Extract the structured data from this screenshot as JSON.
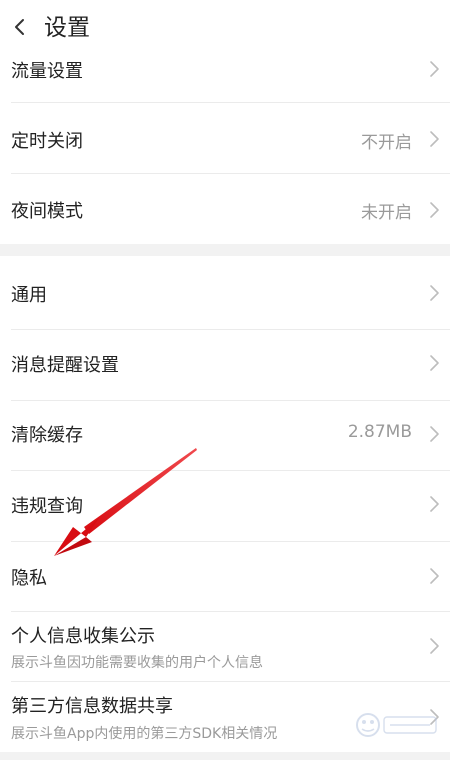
{
  "header": {
    "title": "设置"
  },
  "section1": {
    "rows": [
      {
        "label": "流量设置",
        "value": ""
      },
      {
        "label": "定时关闭",
        "value": "不开启"
      },
      {
        "label": "夜间模式",
        "value": "未开启"
      }
    ]
  },
  "section2": {
    "rows": [
      {
        "label": "通用",
        "value": ""
      },
      {
        "label": "消息提醒设置",
        "value": ""
      },
      {
        "label": "清除缓存",
        "value": "2.87MB"
      },
      {
        "label": "违规查询",
        "value": ""
      },
      {
        "label": "隐私",
        "value": ""
      },
      {
        "label": "个人信息收集公示",
        "sub": "展示斗鱼因功能需要收集的用户个人信息"
      },
      {
        "label": "第三方信息数据共享",
        "sub": "展示斗鱼App内使用的第三方SDK相关情况"
      }
    ]
  },
  "icons": {
    "back": "chevron-left-icon",
    "row_arrow": "chevron-right-icon",
    "annotation": "red-arrow"
  },
  "colors": {
    "background": "#f2f2f2",
    "card": "#ffffff",
    "text": "#222222",
    "secondary_text": "#9a9a9a",
    "chevron": "#bdbdbd",
    "annotation_arrow": "#e8151b"
  }
}
